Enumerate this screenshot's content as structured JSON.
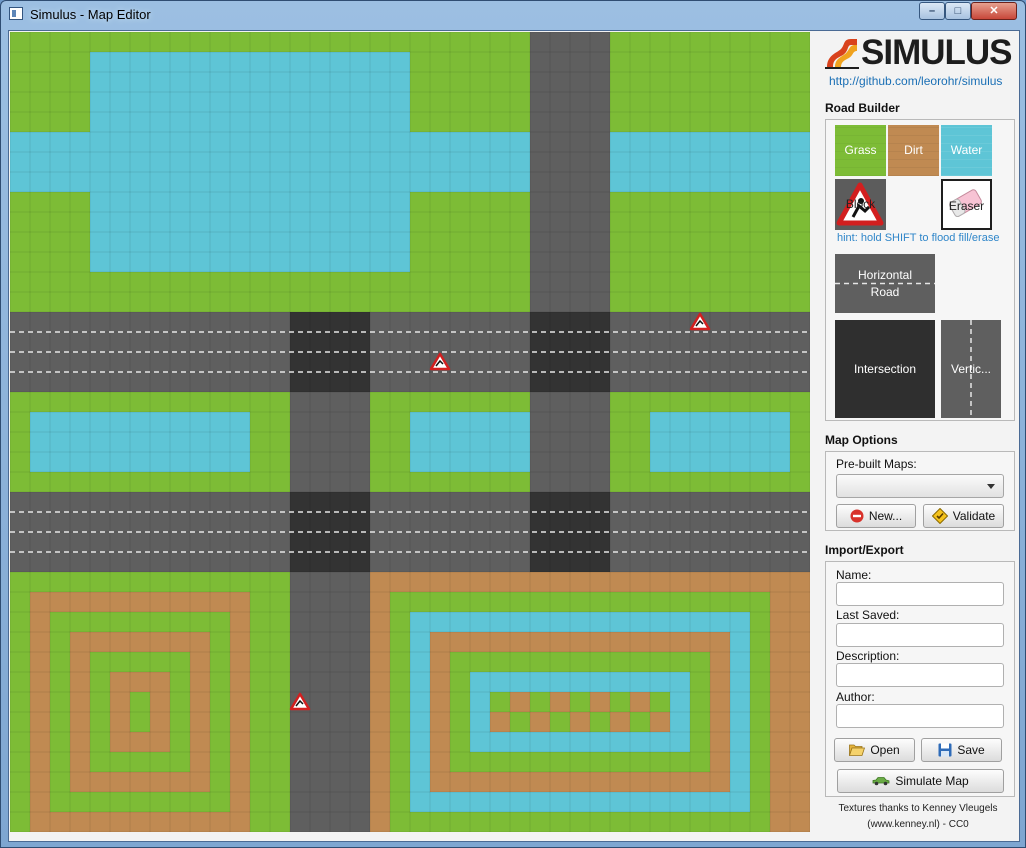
{
  "window": {
    "title": "Simulus - Map Editor",
    "controls": {
      "minimize": "–",
      "maximize": "□",
      "close": "✕"
    }
  },
  "colors": {
    "grass": "#7dbc36",
    "dirt": "#c08a52",
    "water": "#5ec5d6",
    "road": "#5f5f5f",
    "intersection": "#333333",
    "lane_marking": "#e6e6e6",
    "link": "#1a6fb5",
    "hint": "#2f86c9"
  },
  "map": {
    "grid_size": 40,
    "legend": {
      "G": "grass",
      "D": "dirt",
      "W": "water",
      "H": "horizontal-road",
      "V": "vertical-road",
      "I": "intersection"
    },
    "rows": [
      "GGGGGGGGGGGGGGGGGGGGGGGGGGVVVVGGGGGGGGGG",
      "GGGGWWWWWWWWWWWWWWWWGGGGGGVVVVGGGGGGGGGG",
      "GGGGWWWWWWWWWWWWWWWWGGGGGGVVVVGGGGGGGGGG",
      "GGGGWWWWWWWWWWWWWWWWGGGGGGVVVVGGGGGGGGGG",
      "GGGGWWWWWWWWWWWWWWWWGGGGGGVVVVGGGGGGGGGG",
      "WWWWWWWWWWWWWWWWWWWWWWWWWWVVVVWWWWWWWWWW",
      "WWWWWWWWWWWWWWWWWWWWWWWWWWVVVVWWWWWWWWWW",
      "WWWWWWWWWWWWWWWWWWWWWWWWWWVVVVWWWWWWWWWW",
      "GGGGWWWWWWWWWWWWWWWWGGGGGGVVVVGGGGGGGGGG",
      "GGGGWWWWWWWWWWWWWWWWGGGGGGVVVVGGGGGGGGGG",
      "GGGGWWWWWWWWWWWWWWWWGGGGGGVVVVGGGGGGGGGG",
      "GGGGWWWWWWWWWWWWWWWWGGGGGGVVVVGGGGGGGGGG",
      "GGGGGGGGGGGGGGGGGGGGGGGGGGVVVVGGGGGGGGGG",
      "GGGGGGGGGGGGGGGGGGGGGGGGGGVVVVGGGGGGGGGG",
      "HHHHHHHHHHHHHHIIIIHHHHHHHHIIIIHHHHHHHHHH",
      "HHHHHHHHHHHHHHIIIIHHHHHHHHIIIIHHHHHHHHHH",
      "HHHHHHHHHHHHHHIIIIHHHHHHHHIIIIHHHHHHHHHH",
      "HHHHHHHHHHHHHHIIIIHHHHHHHHIIIIHHHHHHHHHH",
      "GGGGGGGGGGGGGGVVVVGGGGGGGGVVVVGGGGGGGGGG",
      "GWWWWWWWWWWWGGVVVVGGWWWWWWVVVVGGWWWWWWWG",
      "GWWWWWWWWWWWGGVVVVGGWWWWWWVVVVGGWWWWWWWG",
      "GWWWWWWWWWWWGGVVVVGGWWWWWWVVVVGGWWWWWWWG",
      "GGGGGGGGGGGGGGVVVVGGGGGGGGVVVVGGGGGGGGGG",
      "HHHHHHHHHHHHHHIIIIHHHHHHHHIIIIHHHHHHHHHH",
      "HHHHHHHHHHHHHHIIIIHHHHHHHHIIIIHHHHHHHHHH",
      "HHHHHHHHHHHHHHIIIIHHHHHHHHIIIIHHHHHHHHHH",
      "HHHHHHHHHHHHHHIIIIHHHHHHHHIIIIHHHHHHHHHH",
      "GGGGGGGGGGGGGGVVVVDDDDDDDDDDDDDDDDDDDDDD",
      "GDDDDDDDDDDDGGVVVVDGGGGGGGGGGGGGGGGGGGDD",
      "GDGGGGGGGGGDGGVVVVDGWWWWWWWWWWWWWWWWWGDD",
      "GDGDDDDDDDGDGGVVVVDGWDDDDDDDDDDDDDDDWGDD",
      "GDGDGGGGGDGDGGVVVVDGWDGGGGGGGGGGGGGDWGDD",
      "GDGDGDDDGDGDGGVVVVDGWDGWWWWWWWWWWWGDWGDD",
      "GDGDGDGDGDGDGGVVVVDGWDGWGDGDGDGDGWGDWGDD",
      "GDGDGDGDGDGDGGVVVVDGWDGWDGDGDGDGDWGDWGDD",
      "GDGDGDDDGDGDGGVVVVDGWDGWWWWWWWWWWWGDWGDD",
      "GDGDGGGGGDGDGGVVVVDGWDGGGGGGGGGGGGGDWGDD",
      "GDGDDDDDDDGDGGVVVVDGWDDDDDDDDDDDDDDDWGDD",
      "GDGGGGGGGGGDGGVVVVDGWWWWWWWWWWWWWWWWWGDD",
      "GDDDDDDDDDDDGGVVVVDGGGGGGGGGGGGGGGGGGGDD"
    ],
    "blocks": [
      {
        "row": 14,
        "col": 34
      },
      {
        "row": 16,
        "col": 21
      },
      {
        "row": 33,
        "col": 14
      }
    ]
  },
  "sidebar": {
    "logo_text": "SIMULUS",
    "github_link": "http://github.com/leorohr/simulus",
    "road_builder": {
      "title": "Road Builder",
      "tiles": {
        "grass": "Grass",
        "dirt": "Dirt",
        "water": "Water",
        "block": "Block",
        "eraser": "Eraser"
      },
      "hint": "hint: hold SHIFT to flood fill/erase",
      "horizontal_road": "Horizontal Road",
      "intersection": "Intersection",
      "vertical_road": "Vertic..."
    },
    "map_options": {
      "title": "Map Options",
      "prebuilt_label": "Pre-built Maps:",
      "prebuilt_value": "",
      "new_button": "New...",
      "validate_button": "Validate"
    },
    "import_export": {
      "title": "Import/Export",
      "name_label": "Name:",
      "name_value": "",
      "last_saved_label": "Last Saved:",
      "last_saved_value": "",
      "description_label": "Description:",
      "description_value": "",
      "author_label": "Author:",
      "author_value": "",
      "open_button": "Open",
      "save_button": "Save",
      "simulate_button": "Simulate Map"
    },
    "credits_line1": "Textures thanks to Kenney Vleugels",
    "credits_line2": "(www.kenney.nl) - CC0"
  }
}
